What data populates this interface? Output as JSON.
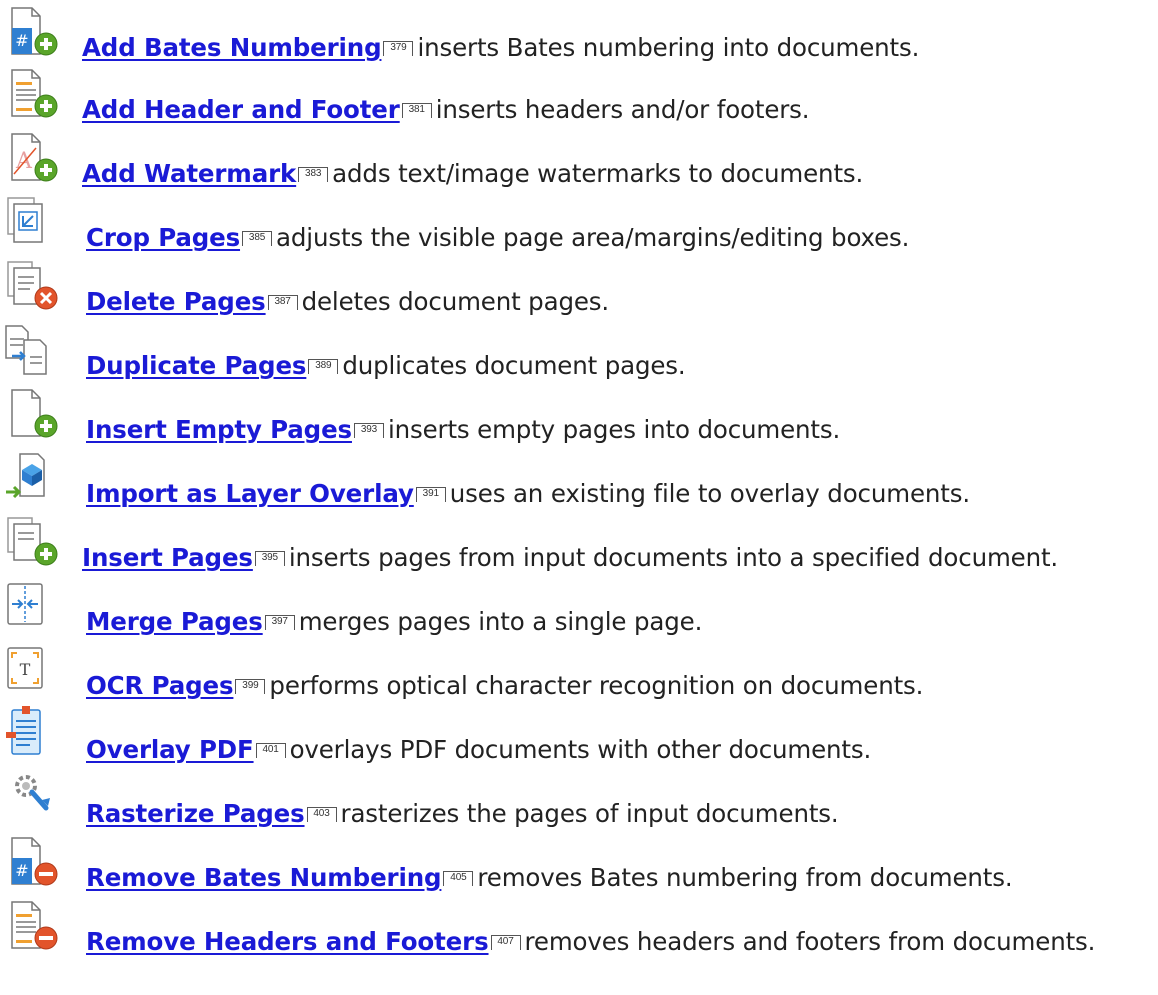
{
  "items": [
    {
      "icon": "bates-add-icon",
      "label": "Add Bates Numbering",
      "ref": "379",
      "desc": "inserts Bates numbering into documents."
    },
    {
      "icon": "header-footer-add-icon",
      "label": "Add Header and Footer",
      "ref": "381",
      "desc": "inserts headers and/or footers."
    },
    {
      "icon": "watermark-add-icon",
      "label": "Add Watermark",
      "ref": "383",
      "desc": "adds text/image watermarks to documents."
    },
    {
      "icon": "crop-pages-icon",
      "label": "Crop Pages",
      "ref": "385",
      "desc": "adjusts the visible page area/margins/editing boxes."
    },
    {
      "icon": "delete-pages-icon",
      "label": "Delete Pages",
      "ref": "387",
      "desc": "deletes document pages."
    },
    {
      "icon": "duplicate-pages-icon",
      "label": "Duplicate Pages",
      "ref": "389",
      "desc": "duplicates document pages."
    },
    {
      "icon": "insert-empty-pages-icon",
      "label": "Insert Empty Pages",
      "ref": "393",
      "desc": "inserts empty pages into documents."
    },
    {
      "icon": "import-layer-overlay-icon",
      "label": "Import as Layer Overlay",
      "ref": "391",
      "desc": "uses an existing file to overlay documents."
    },
    {
      "icon": "insert-pages-icon",
      "label": "Insert Pages",
      "ref": "395",
      "desc": "inserts pages from input documents into a specified document."
    },
    {
      "icon": "merge-pages-icon",
      "label": "Merge Pages",
      "ref": "397",
      "desc": "merges pages into a single page."
    },
    {
      "icon": "ocr-pages-icon",
      "label": "OCR Pages",
      "ref": "399",
      "desc": "performs optical character recognition on documents."
    },
    {
      "icon": "overlay-pdf-icon",
      "label": "Overlay PDF",
      "ref": "401",
      "desc": "overlays PDF documents with other documents."
    },
    {
      "icon": "rasterize-pages-icon",
      "label": "Rasterize Pages",
      "ref": "403",
      "desc": "rasterizes the pages of input documents."
    },
    {
      "icon": "bates-remove-icon",
      "label": "Remove Bates Numbering",
      "ref": "405",
      "desc": "removes Bates numbering from documents."
    },
    {
      "icon": "header-footer-remove-icon",
      "label": "Remove Headers and Footers",
      "ref": "407",
      "desc": "removes headers and footers from documents."
    }
  ],
  "colors": {
    "link": "#1a1ad6",
    "green": "#5aa52a",
    "red": "#e2542b",
    "blue": "#2f7fd1",
    "orange": "#f0a030"
  }
}
